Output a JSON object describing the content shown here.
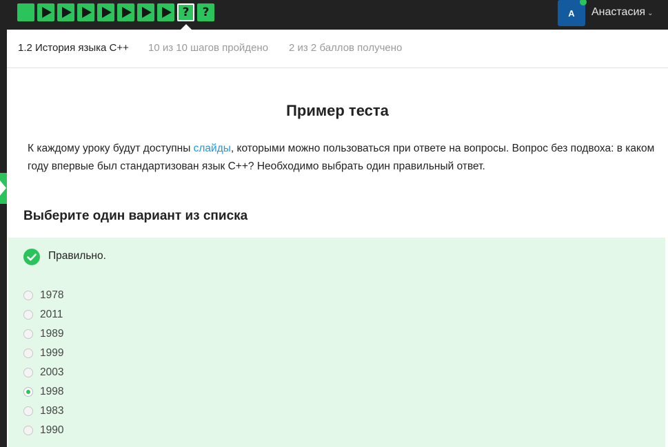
{
  "topbar": {
    "steps": [
      {
        "type": "text",
        "icon": "text-step-icon"
      },
      {
        "type": "video",
        "icon": "play-icon"
      },
      {
        "type": "video",
        "icon": "play-icon"
      },
      {
        "type": "video",
        "icon": "play-icon"
      },
      {
        "type": "video",
        "icon": "play-icon"
      },
      {
        "type": "video",
        "icon": "play-icon"
      },
      {
        "type": "video",
        "icon": "play-icon"
      },
      {
        "type": "video",
        "icon": "play-icon"
      },
      {
        "type": "quiz",
        "label": "?",
        "current": true
      },
      {
        "type": "quiz",
        "label": "?"
      }
    ],
    "user": {
      "avatar_letter": "A",
      "name": "Анастасия",
      "chevron": "⌄",
      "online": true
    }
  },
  "lesson": {
    "title": "1.2 История языка C++",
    "progress": "10 из 10 шагов пройдено",
    "score": "2 из 2 баллов  получено"
  },
  "step": {
    "title": "Пример теста",
    "text_before_link": "К каждому уроку будут доступны ",
    "link_text": "слайды",
    "text_after_link": ", которыми можно пользоваться при ответе на вопросы. Вопрос без подвоха: в каком году впервые был стандартизован язык C++? Необходимо выбрать один правильный ответ."
  },
  "quiz": {
    "prompt": "Выберите один вариант из списка",
    "feedback": "Правильно.",
    "options": [
      "1978",
      "2011",
      "1989",
      "1999",
      "2003",
      "1998",
      "1983",
      "1990"
    ],
    "selected": "1998"
  },
  "colors": {
    "accent_green": "#2bc35c",
    "topbar_bg": "#222222",
    "feedback_bg": "#e3f8e8",
    "link_blue": "#1a9be6",
    "avatar_blue": "#145a9e"
  }
}
